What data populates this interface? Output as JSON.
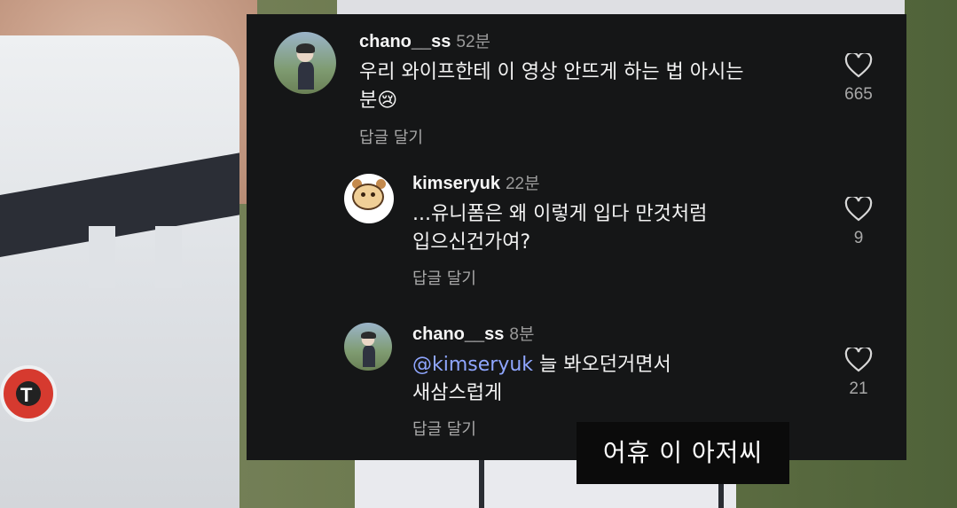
{
  "comments": [
    {
      "username": "chano__ss",
      "time": "52분",
      "text_line1": "우리 와이프한테 이 영상 안뜨게 하는 법 아시는",
      "text_line2": "분😢",
      "reply_label": "답글 달기",
      "likes": "665",
      "avatar": "profile-photo"
    },
    {
      "username": "kimseryuk",
      "time": "22분",
      "text_line1": "...유니폼은 왜 이렇게 입다 만것처럼",
      "text_line2": "입으신건가여?",
      "reply_label": "답글 달기",
      "likes": "9",
      "avatar": "bear-cartoon"
    },
    {
      "username": "chano__ss",
      "time": "8분",
      "mention": "@kimseryuk",
      "text_line1": " 늘 봐오던거면서",
      "text_line2": "새삼스럽게",
      "reply_label": "답글 달기",
      "likes": "21",
      "avatar": "profile-photo"
    }
  ],
  "subtitle": "어휴  이  아저씨",
  "colors": {
    "panel_bg": "#151617",
    "mention": "#8fa6ff",
    "subtitle_bg": "#0b0b0b"
  }
}
